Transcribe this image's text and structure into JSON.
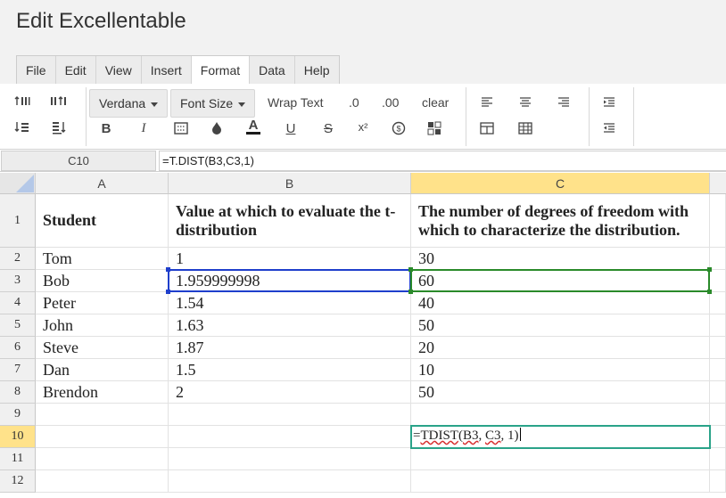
{
  "app": {
    "title": "Edit Excellentable"
  },
  "menu": {
    "tabs": [
      "File",
      "Edit",
      "View",
      "Insert",
      "Format",
      "Data",
      "Help"
    ],
    "active": "Format"
  },
  "toolbar": {
    "font_family": "Verdana",
    "font_size_label": "Font Size",
    "wrap_text_label": "Wrap Text",
    "decimal_decrease_label": ".0",
    "decimal_increase_label": ".00",
    "clear_label": "clear",
    "bold_label": "B",
    "italic_label": "I",
    "text_color_label": "A",
    "underline_label": "U",
    "strike_label": "S",
    "superscript_label": "x²",
    "accent_color": "#1a1a1a"
  },
  "formula_bar": {
    "cell_ref": "C10",
    "formula": "=T.DIST(B3,C3,1)"
  },
  "columns": [
    "A",
    "B",
    "C"
  ],
  "selected_column": "C",
  "rows": [
    {
      "num": "1",
      "A": "Student",
      "B": "Value at which to evaluate the t-distribution",
      "C": "The number of degrees of freedom with which to characterize the distribution."
    },
    {
      "num": "2",
      "A": "Tom",
      "B": "1",
      "C": "30"
    },
    {
      "num": "3",
      "A": "Bob",
      "B": "1.959999998",
      "C": "60"
    },
    {
      "num": "4",
      "A": "Peter",
      "B": "1.54",
      "C": "40"
    },
    {
      "num": "5",
      "A": "John",
      "B": "1.63",
      "C": "50"
    },
    {
      "num": "6",
      "A": "Steve",
      "B": "1.87",
      "C": "20"
    },
    {
      "num": "7",
      "A": "Dan",
      "B": "1.5",
      "C": "10"
    },
    {
      "num": "8",
      "A": "Brendon",
      "B": "2",
      "C": "50"
    },
    {
      "num": "9",
      "A": "",
      "B": "",
      "C": ""
    },
    {
      "num": "10",
      "A": "",
      "B": "",
      "C": ""
    },
    {
      "num": "11",
      "A": "",
      "B": "",
      "C": ""
    },
    {
      "num": "12",
      "A": "",
      "B": "",
      "C": ""
    }
  ],
  "selected_row": "10",
  "editor": {
    "prefix": "=",
    "fn": "TDIST",
    "open": "(",
    "arg1": "B3",
    "sep1": ", ",
    "arg2": "C3",
    "rest": ", 1)"
  },
  "colors": {
    "range_b": "#1f3fcc",
    "range_c": "#2a8a2a",
    "editor_border": "#2aa389",
    "selected_header": "#ffe28a"
  }
}
